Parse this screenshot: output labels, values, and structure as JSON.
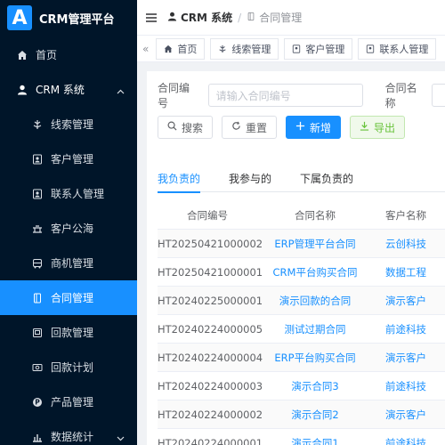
{
  "brand": {
    "logo_letter": "A",
    "title": "CRM管理平台"
  },
  "sidebar": {
    "items": [
      {
        "label": "首页",
        "icon": "home-icon"
      },
      {
        "label": "CRM 系统",
        "icon": "user-icon"
      },
      {
        "label": "线索管理",
        "icon": "leads-icon"
      },
      {
        "label": "客户管理",
        "icon": "customer-icon"
      },
      {
        "label": "联系人管理",
        "icon": "contact-icon"
      },
      {
        "label": "客户公海",
        "icon": "pool-icon"
      },
      {
        "label": "商机管理",
        "icon": "bus-icon"
      },
      {
        "label": "合同管理",
        "icon": "contract-icon"
      },
      {
        "label": "回款管理",
        "icon": "payment-icon"
      },
      {
        "label": "回款计划",
        "icon": "plan-icon"
      },
      {
        "label": "产品管理",
        "icon": "product-icon"
      },
      {
        "label": "数据统计",
        "icon": "stats-icon"
      }
    ]
  },
  "header": {
    "crumb1": "CRM 系统",
    "crumb2": "合同管理"
  },
  "tabs": [
    "首页",
    "线索管理",
    "客户管理",
    "联系人管理"
  ],
  "filters": {
    "code_label": "合同编号",
    "code_placeholder": "请输入合同编号",
    "name_label": "合同名称"
  },
  "buttons": {
    "search": "搜索",
    "reset": "重置",
    "add": "新增",
    "export": "导出"
  },
  "subtabs": [
    "我负责的",
    "我参与的",
    "下属负责的"
  ],
  "table": {
    "headers": [
      "合同编号",
      "合同名称",
      "客户名称"
    ],
    "rows": [
      [
        "HT20250421000002",
        "ERP管理平台合同",
        "云创科技"
      ],
      [
        "HT20250421000001",
        "CRM平台购买合同",
        "数据工程"
      ],
      [
        "HT20240225000001",
        "演示回款的合同",
        "演示客户"
      ],
      [
        "HT20240224000005",
        "测试过期合同",
        "前途科技"
      ],
      [
        "HT20240224000004",
        "ERP平台购买合同",
        "演示客户"
      ],
      [
        "HT20240224000003",
        "演示合同3",
        "前途科技"
      ],
      [
        "HT20240224000002",
        "演示合同2",
        "演示客户"
      ],
      [
        "HT20240224000001",
        "演示合同1",
        "前途科技"
      ]
    ]
  },
  "colors": {
    "primary": "#1890ff",
    "sidebar_bg": "#001529",
    "success": "#67c23a"
  }
}
